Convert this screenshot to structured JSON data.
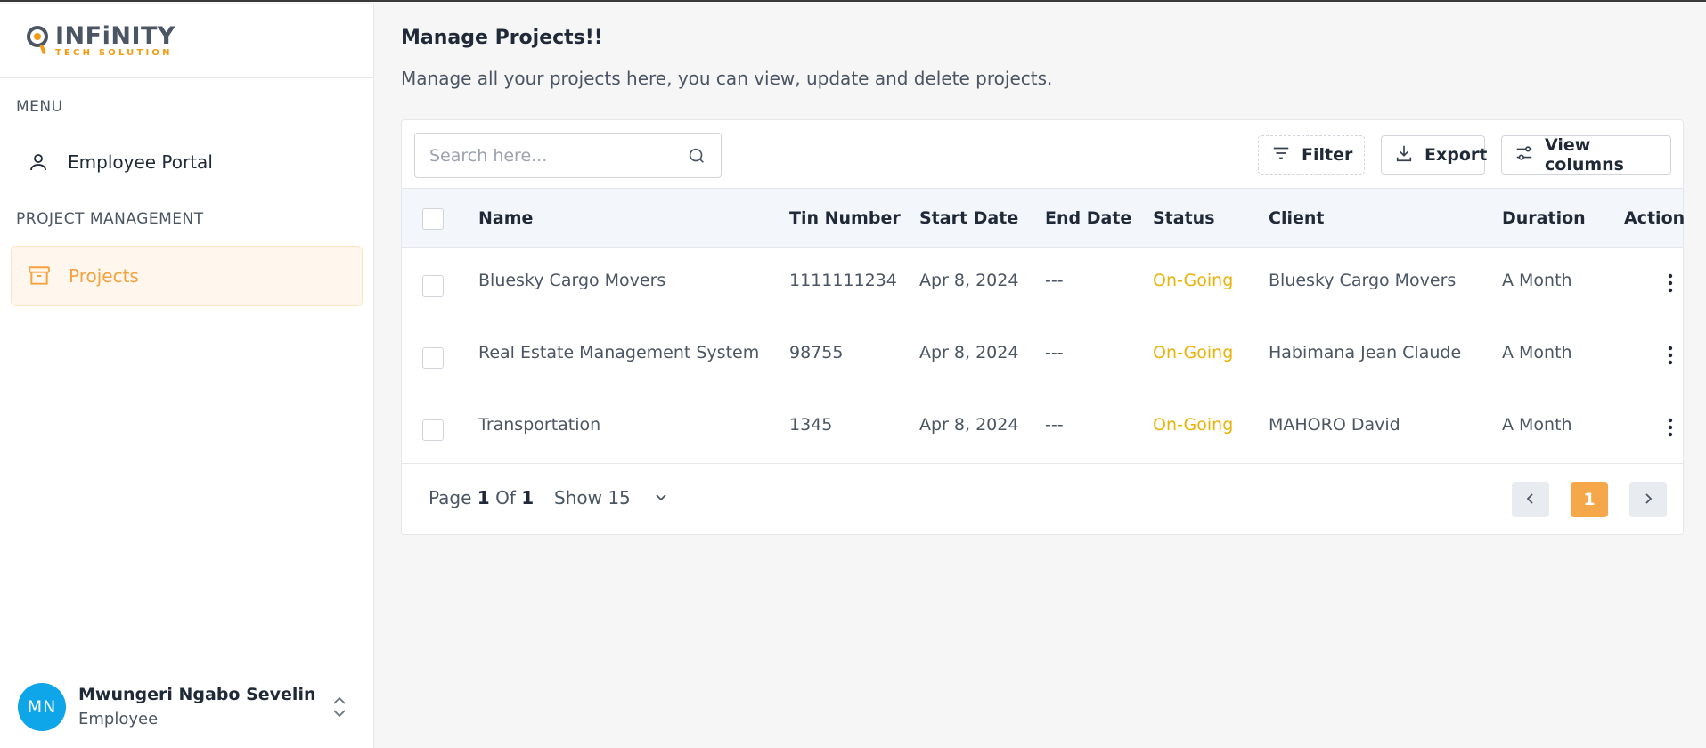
{
  "brand": {
    "title": "INFiNITY",
    "subtitle": "TECH SOLUTION"
  },
  "sidebar": {
    "menu_label": "MENU",
    "employee_portal": "Employee Portal",
    "project_label": "PROJECT MANAGEMENT",
    "projects": "Projects"
  },
  "user": {
    "initials": "MN",
    "name": "Mwungeri Ngabo Sevelin",
    "role": "Employee"
  },
  "page": {
    "title": "Manage Projects!!",
    "subtitle": "Manage all your projects here, you can view, update and delete projects."
  },
  "toolbar": {
    "search_placeholder": "Search here...",
    "filter": "Filter",
    "export": "Export",
    "view_columns": "View columns"
  },
  "table": {
    "headers": {
      "name": "Name",
      "tin": "Tin Number",
      "start": "Start Date",
      "end": "End Date",
      "status": "Status",
      "client": "Client",
      "duration": "Duration",
      "action": "Action"
    },
    "rows": [
      {
        "name": "Bluesky Cargo Movers",
        "tin": "1111111234",
        "start": "Apr 8, 2024",
        "end": "---",
        "status": "On-Going",
        "client": "Bluesky Cargo Movers",
        "duration": "A Month"
      },
      {
        "name": "Real Estate Management System",
        "tin": "98755",
        "start": "Apr 8, 2024",
        "end": "---",
        "status": "On-Going",
        "client": "Habimana Jean Claude",
        "duration": "A Month"
      },
      {
        "name": "Transportation",
        "tin": "1345",
        "start": "Apr 8, 2024",
        "end": "---",
        "status": "On-Going",
        "client": "MAHORO David",
        "duration": "A Month"
      }
    ]
  },
  "pagination": {
    "page_word": "Page",
    "current": "1",
    "of_word": "Of",
    "total": "1",
    "show": "Show 15",
    "active_page": "1"
  },
  "colors": {
    "accent": "#f5a23f",
    "status_ongoing": "#eab308",
    "avatar": "#0ea5e9"
  }
}
